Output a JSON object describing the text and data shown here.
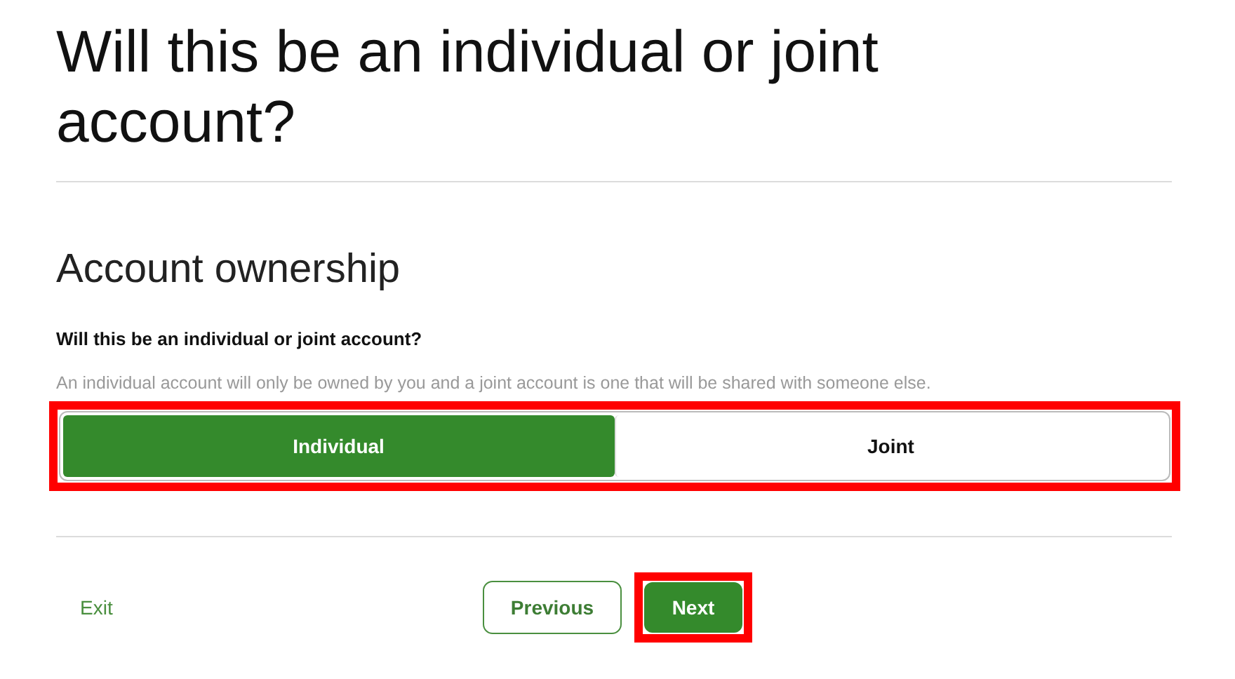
{
  "title": "Will this be an individual or joint account?",
  "section": {
    "heading": "Account ownership",
    "question": "Will this be an individual or joint account?",
    "hint": "An individual account will only be owned by you and a joint account is one that will be shared with someone else.",
    "highlighted": true,
    "options": [
      {
        "label": "Individual",
        "selected": true
      },
      {
        "label": "Joint",
        "selected": false
      }
    ]
  },
  "footer": {
    "exit": "Exit",
    "previous": "Previous",
    "next": {
      "label": "Next",
      "highlighted": true
    }
  }
}
